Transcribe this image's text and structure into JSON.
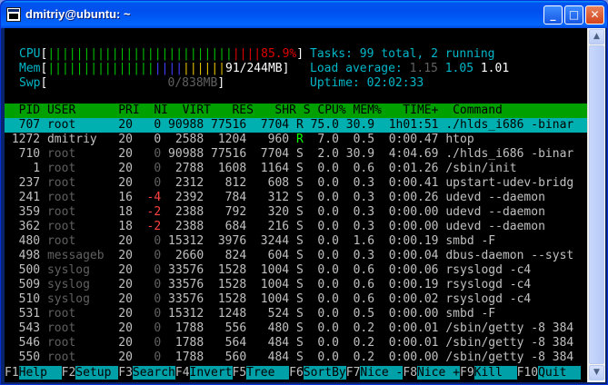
{
  "window": {
    "title": "dmitriy@ubuntu: ~",
    "buttons": {
      "minimize": "_",
      "maximize": "□",
      "close": "✕"
    }
  },
  "meters": {
    "cpu": {
      "label": "CPU",
      "value": "85.9%",
      "bar_green": "||||||||||||||||||||||||||",
      "bar_red": "||||",
      "pad": " "
    },
    "mem": {
      "label": "Mem",
      "value": "91/244MB",
      "bar_green": "|||||||||||||||",
      "bar_blue": "||||",
      "bar_yellow": "||||||"
    },
    "swp": {
      "label": "Swp",
      "value": "0/838MB"
    }
  },
  "summary": {
    "tasks_label": "Tasks: ",
    "tasks_value": "99 total, 2 running",
    "load_label": "Load average: ",
    "load_1": "1.15",
    "load_5": "1.05",
    "load_15": "1.01",
    "uptime_label": "Uptime: ",
    "uptime_value": "02:02:33"
  },
  "table_header": "  PID USER      PRI  NI  VIRT   RES   SHR S CPU% MEM%   TIME+  Command",
  "processes": [
    {
      "pid": "707",
      "user": "root",
      "pri": "20",
      "ni": "0",
      "virt": "90988",
      "res": "77516",
      "shr": "7704",
      "s": "R",
      "cpu": "75.0",
      "mem": "30.9",
      "time": "1h01:51",
      "cmd": "./hlds_i686 -binar",
      "selected": true
    },
    {
      "pid": "1272",
      "user": "dmitriy",
      "pri": "20",
      "ni": "0",
      "virt": "2588",
      "res": "1204",
      "shr": "960",
      "s": "R",
      "cpu": "7.0",
      "mem": "0.5",
      "time": "0:00.47",
      "cmd": "htop"
    },
    {
      "pid": "710",
      "user": "root",
      "pri": "20",
      "ni": "0",
      "virt": "90988",
      "res": "77516",
      "shr": "7704",
      "s": "S",
      "cpu": "2.0",
      "mem": "30.9",
      "time": "4:04.69",
      "cmd": "./hlds_i686 -binar"
    },
    {
      "pid": "1",
      "user": "root",
      "pri": "20",
      "ni": "0",
      "virt": "2788",
      "res": "1608",
      "shr": "1164",
      "s": "S",
      "cpu": "0.0",
      "mem": "0.6",
      "time": "0:01.26",
      "cmd": "/sbin/init"
    },
    {
      "pid": "237",
      "user": "root",
      "pri": "20",
      "ni": "0",
      "virt": "2312",
      "res": "812",
      "shr": "608",
      "s": "S",
      "cpu": "0.0",
      "mem": "0.3",
      "time": "0:00.41",
      "cmd": "upstart-udev-bridg"
    },
    {
      "pid": "241",
      "user": "root",
      "pri": "16",
      "ni": "-4",
      "virt": "2392",
      "res": "784",
      "shr": "312",
      "s": "S",
      "cpu": "0.0",
      "mem": "0.3",
      "time": "0:00.26",
      "cmd": "udevd --daemon"
    },
    {
      "pid": "359",
      "user": "root",
      "pri": "18",
      "ni": "-2",
      "virt": "2388",
      "res": "792",
      "shr": "320",
      "s": "S",
      "cpu": "0.0",
      "mem": "0.3",
      "time": "0:00.00",
      "cmd": "udevd --daemon"
    },
    {
      "pid": "362",
      "user": "root",
      "pri": "18",
      "ni": "-2",
      "virt": "2388",
      "res": "684",
      "shr": "216",
      "s": "S",
      "cpu": "0.0",
      "mem": "0.3",
      "time": "0:00.00",
      "cmd": "udevd --daemon"
    },
    {
      "pid": "480",
      "user": "root",
      "pri": "20",
      "ni": "0",
      "virt": "15312",
      "res": "3976",
      "shr": "3244",
      "s": "S",
      "cpu": "0.0",
      "mem": "1.6",
      "time": "0:00.19",
      "cmd": "smbd -F"
    },
    {
      "pid": "498",
      "user": "messageb",
      "pri": "20",
      "ni": "0",
      "virt": "2660",
      "res": "824",
      "shr": "604",
      "s": "S",
      "cpu": "0.0",
      "mem": "0.3",
      "time": "0:00.04",
      "cmd": "dbus-daemon --syst"
    },
    {
      "pid": "500",
      "user": "syslog",
      "pri": "20",
      "ni": "0",
      "virt": "33576",
      "res": "1528",
      "shr": "1004",
      "s": "S",
      "cpu": "0.0",
      "mem": "0.6",
      "time": "0:00.06",
      "cmd": "rsyslogd -c4"
    },
    {
      "pid": "509",
      "user": "syslog",
      "pri": "20",
      "ni": "0",
      "virt": "33576",
      "res": "1528",
      "shr": "1004",
      "s": "S",
      "cpu": "0.0",
      "mem": "0.6",
      "time": "0:00.19",
      "cmd": "rsyslogd -c4"
    },
    {
      "pid": "510",
      "user": "syslog",
      "pri": "20",
      "ni": "0",
      "virt": "33576",
      "res": "1528",
      "shr": "1004",
      "s": "S",
      "cpu": "0.0",
      "mem": "0.6",
      "time": "0:00.02",
      "cmd": "rsyslogd -c4"
    },
    {
      "pid": "531",
      "user": "root",
      "pri": "20",
      "ni": "0",
      "virt": "15312",
      "res": "1248",
      "shr": "524",
      "s": "S",
      "cpu": "0.0",
      "mem": "0.5",
      "time": "0:00.00",
      "cmd": "smbd -F"
    },
    {
      "pid": "543",
      "user": "root",
      "pri": "20",
      "ni": "0",
      "virt": "1788",
      "res": "556",
      "shr": "480",
      "s": "S",
      "cpu": "0.0",
      "mem": "0.2",
      "time": "0:00.01",
      "cmd": "/sbin/getty -8 384"
    },
    {
      "pid": "546",
      "user": "root",
      "pri": "20",
      "ni": "0",
      "virt": "1788",
      "res": "564",
      "shr": "484",
      "s": "S",
      "cpu": "0.0",
      "mem": "0.2",
      "time": "0:00.01",
      "cmd": "/sbin/getty -8 384"
    },
    {
      "pid": "550",
      "user": "root",
      "pri": "20",
      "ni": "0",
      "virt": "1788",
      "res": "560",
      "shr": "484",
      "s": "S",
      "cpu": "0.0",
      "mem": "0.2",
      "time": "0:00.00",
      "cmd": "/sbin/getty -8 384"
    }
  ],
  "function_keys": [
    {
      "key": "F1",
      "label": "Help  "
    },
    {
      "key": "F2",
      "label": "Setup "
    },
    {
      "key": "F3",
      "label": "Search"
    },
    {
      "key": "F4",
      "label": "Invert"
    },
    {
      "key": "F5",
      "label": "Tree  "
    },
    {
      "key": "F6",
      "label": "SortBy"
    },
    {
      "key": "F7",
      "label": "Nice -"
    },
    {
      "key": "F8",
      "label": "Nice +"
    },
    {
      "key": "F9",
      "label": "Kill  "
    },
    {
      "key": "F10",
      "label": "Quit  "
    }
  ],
  "colors": {
    "header_bg": "#00a000",
    "selected_bg": "#00b0b0",
    "cyan": "#00b7c8",
    "green": "#00c000",
    "red": "#e00000"
  }
}
